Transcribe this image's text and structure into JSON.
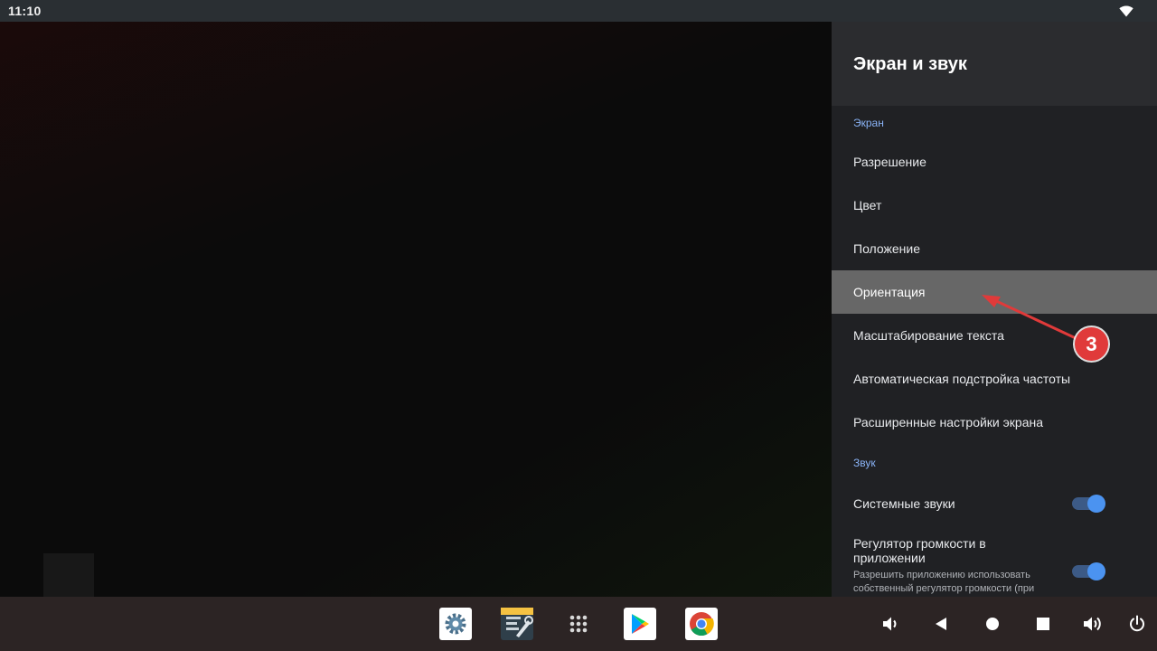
{
  "status_bar": {
    "time": "11:10",
    "wifi_icon": "wifi-icon"
  },
  "settings": {
    "title": "Экран и звук",
    "screen_section": "Экран",
    "screen_items": [
      {
        "label": "Разрешение"
      },
      {
        "label": "Цвет"
      },
      {
        "label": "Положение"
      },
      {
        "label": "Ориентация",
        "focused": true
      },
      {
        "label": "Масштабирование текста"
      },
      {
        "label": "Автоматическая подстройка частоты"
      },
      {
        "label": "Расширенные настройки экрана"
      }
    ],
    "sound_section": "Звук",
    "system_sounds": {
      "label": "Системные звуки",
      "enabled": true
    },
    "app_volume": {
      "label": "Регулятор громкости в приложении",
      "description": "Разрешить приложению использовать собственный регулятор громкости (при",
      "enabled": true
    }
  },
  "annotation": {
    "number": "3",
    "color": "#e03a3a"
  },
  "taskbar": {
    "apps": [
      "settings-app-icon",
      "file-manager-app-icon",
      "app-drawer-icon",
      "play-store-icon",
      "chrome-icon"
    ],
    "system_buttons": [
      "volume-down-icon",
      "back-icon",
      "home-icon",
      "recents-icon",
      "volume-up-icon",
      "power-icon"
    ]
  },
  "colors": {
    "accent": "#8ab4f8",
    "toggle_thumb": "#4b93f0",
    "focus_bg": "#676767",
    "panel_bg": "#202124"
  }
}
